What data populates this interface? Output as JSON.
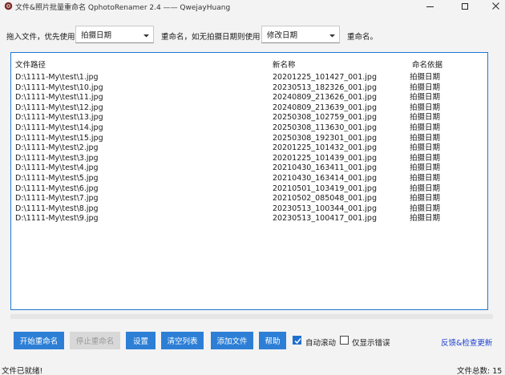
{
  "window": {
    "title": "文件&照片批量重命名 QphotoRenamer 2.4 —— QwejayHuang"
  },
  "options": {
    "drag_label": "拖入文件，优先使用",
    "primary_select": "拍摄日期",
    "fallback_label": "重命名，如无拍摄日期则使用",
    "fallback_select": "修改日期",
    "end_label": "重命名。"
  },
  "table": {
    "headers": [
      "文件路径",
      "新名称",
      "命名依据"
    ],
    "rows": [
      {
        "path": "D:\\1111-My\\test\\1.jpg",
        "new_name": "20201225_101427_001.jpg",
        "basis": "拍摄日期"
      },
      {
        "path": "D:\\1111-My\\test\\10.jpg",
        "new_name": "20230513_182326_001.jpg",
        "basis": "拍摄日期"
      },
      {
        "path": "D:\\1111-My\\test\\11.jpg",
        "new_name": "20240809_213626_001.jpg",
        "basis": "拍摄日期"
      },
      {
        "path": "D:\\1111-My\\test\\12.jpg",
        "new_name": "20240809_213639_001.jpg",
        "basis": "拍摄日期"
      },
      {
        "path": "D:\\1111-My\\test\\13.jpg",
        "new_name": "20250308_102759_001.jpg",
        "basis": "拍摄日期"
      },
      {
        "path": "D:\\1111-My\\test\\14.jpg",
        "new_name": "20250308_113630_001.jpg",
        "basis": "拍摄日期"
      },
      {
        "path": "D:\\1111-My\\test\\15.jpg",
        "new_name": "20250308_192301_001.jpg",
        "basis": "拍摄日期"
      },
      {
        "path": "D:\\1111-My\\test\\2.jpg",
        "new_name": "20201225_101432_001.jpg",
        "basis": "拍摄日期"
      },
      {
        "path": "D:\\1111-My\\test\\3.jpg",
        "new_name": "20201225_101439_001.jpg",
        "basis": "拍摄日期"
      },
      {
        "path": "D:\\1111-My\\test\\4.jpg",
        "new_name": "20210430_163411_001.jpg",
        "basis": "拍摄日期"
      },
      {
        "path": "D:\\1111-My\\test\\5.jpg",
        "new_name": "20210430_163414_001.jpg",
        "basis": "拍摄日期"
      },
      {
        "path": "D:\\1111-My\\test\\6.jpg",
        "new_name": "20210501_103419_001.jpg",
        "basis": "拍摄日期"
      },
      {
        "path": "D:\\1111-My\\test\\7.jpg",
        "new_name": "20210502_085048_001.jpg",
        "basis": "拍摄日期"
      },
      {
        "path": "D:\\1111-My\\test\\8.jpg",
        "new_name": "20230513_100344_001.jpg",
        "basis": "拍摄日期"
      },
      {
        "path": "D:\\1111-My\\test\\9.jpg",
        "new_name": "20230513_100417_001.jpg",
        "basis": "拍摄日期"
      }
    ]
  },
  "buttons": {
    "start": "开始重命名",
    "stop": "停止重命名",
    "settings": "设置",
    "clear": "清空列表",
    "add": "添加文件",
    "help": "帮助"
  },
  "checkboxes": {
    "auto_scroll": {
      "label": "自动滚动",
      "checked": true
    },
    "errors_only": {
      "label": "仅显示错误",
      "checked": false
    }
  },
  "feedback_link": "反馈&检查更新",
  "status": {
    "left": "文件已就绪!",
    "right": "文件总数: 15"
  },
  "colors": {
    "accent": "#2d7fd6",
    "list_border": "#1e78d2",
    "link": "#1a3fd1"
  },
  "progress": 0
}
